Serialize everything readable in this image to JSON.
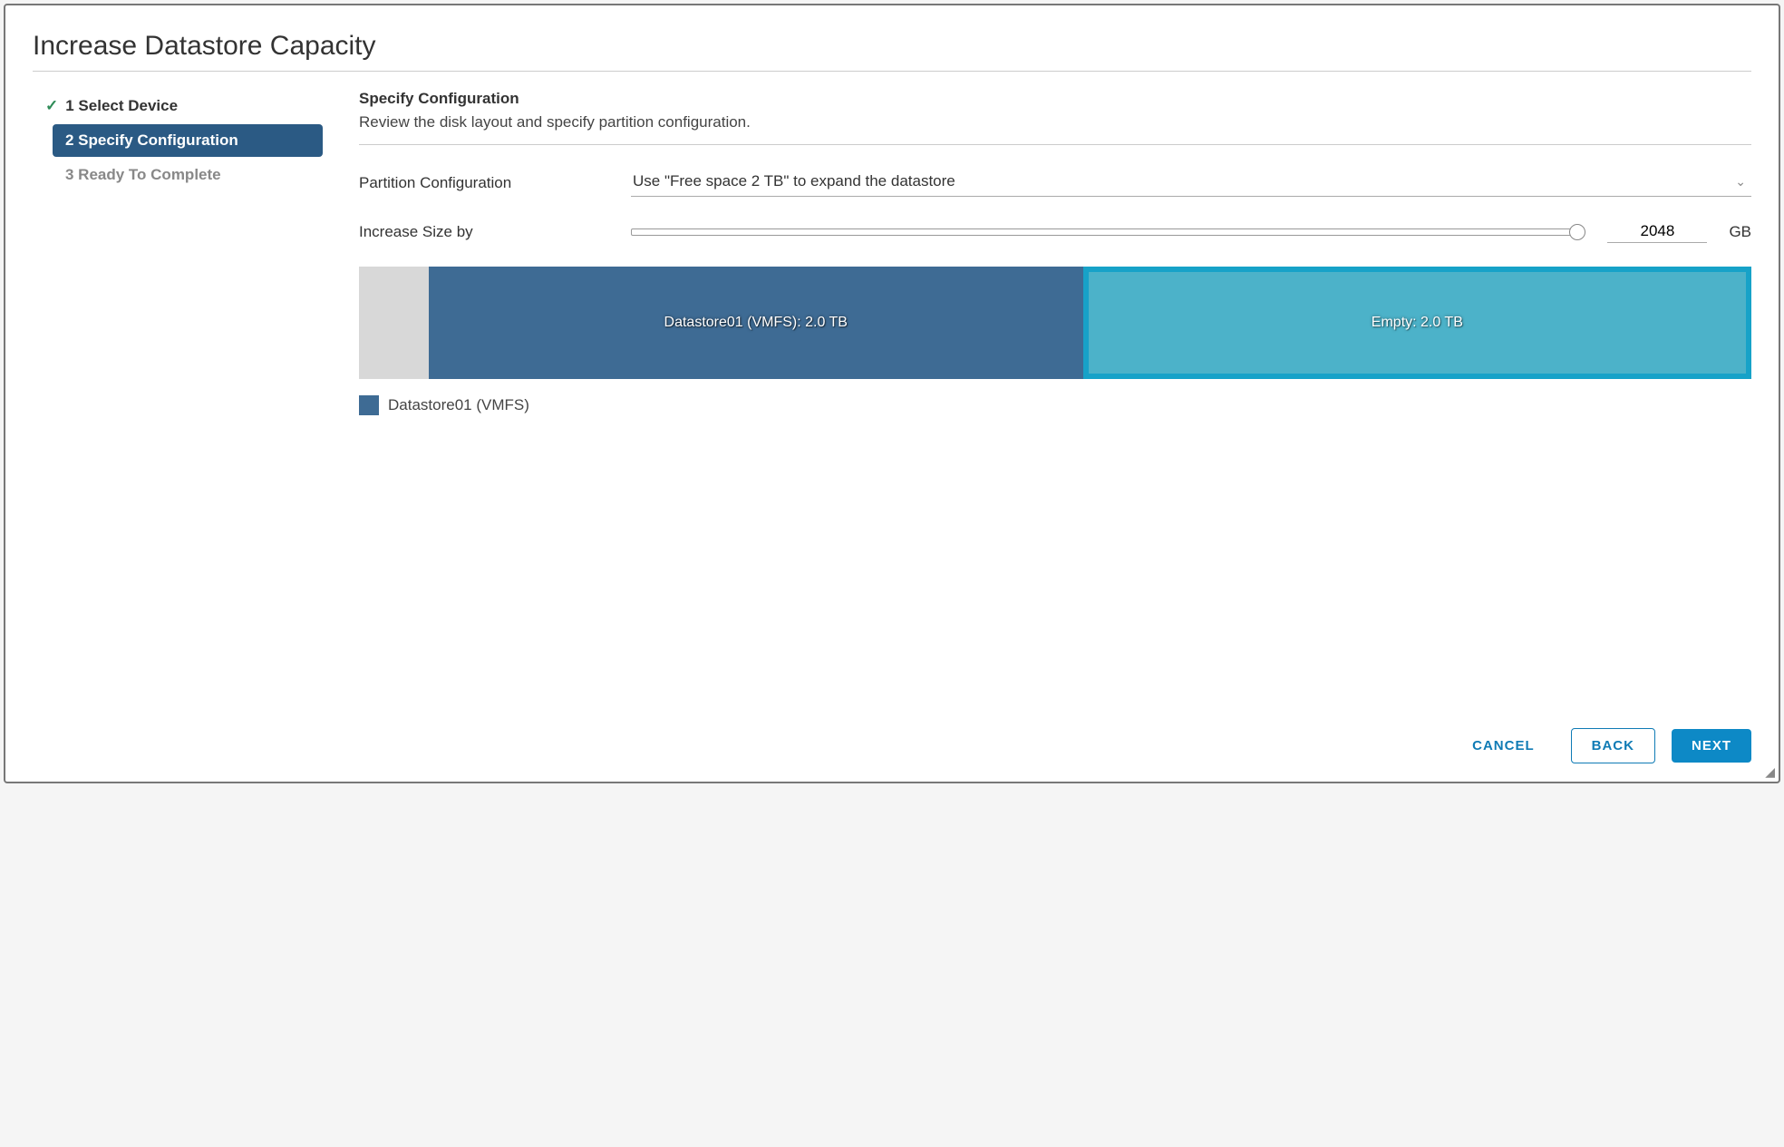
{
  "dialog": {
    "title": "Increase Datastore Capacity"
  },
  "nav": {
    "items": [
      {
        "label": "1 Select Device"
      },
      {
        "label": "2 Specify Configuration"
      },
      {
        "label": "3 Ready To Complete"
      }
    ]
  },
  "section": {
    "title": "Specify Configuration",
    "subtitle": "Review the disk layout and specify partition configuration."
  },
  "form": {
    "partition_label": "Partition Configuration",
    "partition_value": "Use \"Free space 2 TB\" to expand the datastore",
    "increase_label": "Increase Size by",
    "increase_value": "2048",
    "increase_unit": "GB"
  },
  "disk": {
    "datastore_label": "Datastore01 (VMFS): 2.0 TB",
    "empty_label": "Empty: 2.0 TB"
  },
  "legend": {
    "datastore": "Datastore01 (VMFS)"
  },
  "footer": {
    "cancel": "CANCEL",
    "back": "BACK",
    "next": "NEXT"
  }
}
